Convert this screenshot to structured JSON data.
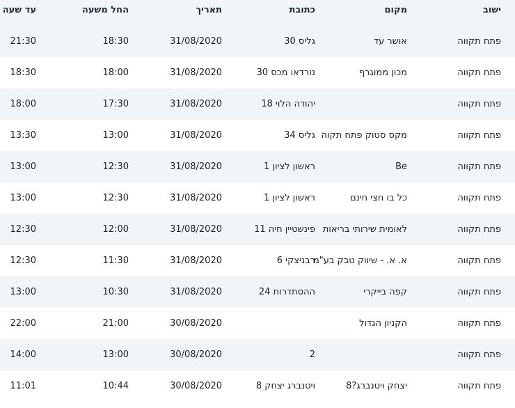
{
  "table": {
    "headers": {
      "city": "ישוב",
      "place": "מקום",
      "address": "כתובת",
      "date": "תאריך",
      "start": "החל משעה",
      "end": "עד שעה"
    },
    "rows": [
      {
        "city": "פתח תקווה",
        "place": "אושר עד",
        "address": "גליס 30",
        "date": "31/08/2020",
        "start": "18:30",
        "end": "21:30"
      },
      {
        "city": "פתח תקווה",
        "place": "מכון ממוגרף",
        "address": "נורדאו מכס 30",
        "date": "31/08/2020",
        "start": "18:00",
        "end": "18:30"
      },
      {
        "city": "פתח תקווה",
        "place": "",
        "address": "יהודה הלוי 18",
        "date": "31/08/2020",
        "start": "17:30",
        "end": "18:00"
      },
      {
        "city": "פתח תקווה",
        "place": "מקס סטוק פתח תקוה",
        "address": "גליס 34",
        "date": "31/08/2020",
        "start": "13:00",
        "end": "13:30"
      },
      {
        "city": "פתח תקווה",
        "place": "Be",
        "address": "ראשון לציון 1",
        "date": "31/08/2020",
        "start": "12:30",
        "end": "13:00"
      },
      {
        "city": "פתח תקווה",
        "place": "כל בו חצי חינם",
        "address": "ראשון לציון 1",
        "date": "31/08/2020",
        "start": "12:30",
        "end": "13:00"
      },
      {
        "city": "פתח תקווה",
        "place": "לאומית שירותי בריאות",
        "address": "פינשטיין חיה 11",
        "date": "31/08/2020",
        "start": "12:00",
        "end": "12:30"
      },
      {
        "city": "פתח תקווה",
        "place": "א. א. - שיווק טבק בע\"מ",
        "address": "רבניצקי 6",
        "date": "31/08/2020",
        "start": "11:30",
        "end": "12:30"
      },
      {
        "city": "פתח תקווה",
        "place": "קפה בייקרי",
        "address": "ההסתדרות 24",
        "date": "31/08/2020",
        "start": "10:30",
        "end": "13:00"
      },
      {
        "city": "פתח תקווה",
        "place": "הקניון הגדול",
        "address": "",
        "date": "30/08/2020",
        "start": "21:00",
        "end": "22:00"
      },
      {
        "city": "פתח תקווה",
        "place": "",
        "address": "2",
        "date": "30/08/2020",
        "start": "13:00",
        "end": "14:00"
      },
      {
        "city": "פתח תקווה",
        "place": "יצחק ויטנברג?8",
        "address": "ויטנברג יצחק 8",
        "date": "30/08/2020",
        "start": "10:44",
        "end": "11:01"
      }
    ]
  },
  "colors": {
    "stripe": "#f2f5f8",
    "background": "#ffffff",
    "text": "#222222"
  }
}
